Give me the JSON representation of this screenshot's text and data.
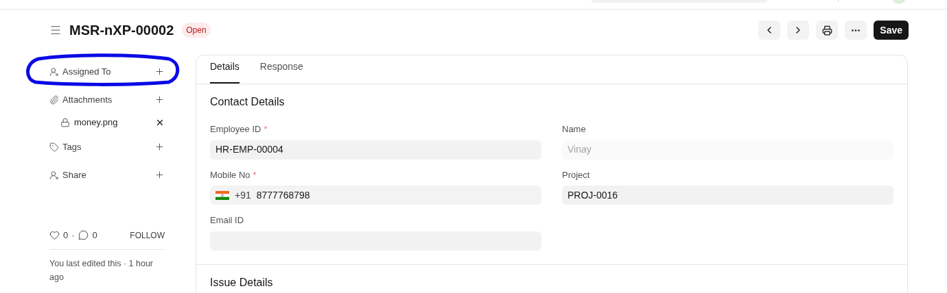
{
  "header": {
    "title": "MSR-nXP-00002",
    "status": "Open",
    "save_label": "Save"
  },
  "sidebar": {
    "sections": [
      {
        "kind": "assign",
        "label": "Assigned To"
      },
      {
        "kind": "attach",
        "label": "Attachments",
        "files": [
          {
            "name": "money.png"
          }
        ]
      },
      {
        "kind": "tag",
        "label": "Tags"
      },
      {
        "kind": "share",
        "label": "Share"
      }
    ],
    "likes": "0",
    "separator": "·",
    "comments": "0",
    "follow": "FOLLOW",
    "last_edited": "You last edited this · 1 hour ago"
  },
  "tabs": [
    {
      "label": "Details",
      "selected": true
    },
    {
      "label": "Response",
      "selected": false
    }
  ],
  "sections": [
    {
      "title": "Contact Details",
      "columns": [
        [
          {
            "kind": "text",
            "label": "Employee ID",
            "required_mark": "*",
            "value": "HR-EMP-00004",
            "disabled": false
          },
          {
            "kind": "phone",
            "label": "Mobile No",
            "required_mark": "*",
            "dial_code": "+91",
            "value": "8777768798",
            "disabled": false
          },
          {
            "kind": "text",
            "label": "Email ID"
          }
        ],
        [
          {
            "kind": "text",
            "label": "Name",
            "value": "Vinay",
            "disabled": true
          },
          {
            "kind": "text",
            "label": "Project",
            "value": "PROJ-0016",
            "disabled": false
          }
        ]
      ]
    },
    {
      "title": "Issue Details"
    }
  ]
}
